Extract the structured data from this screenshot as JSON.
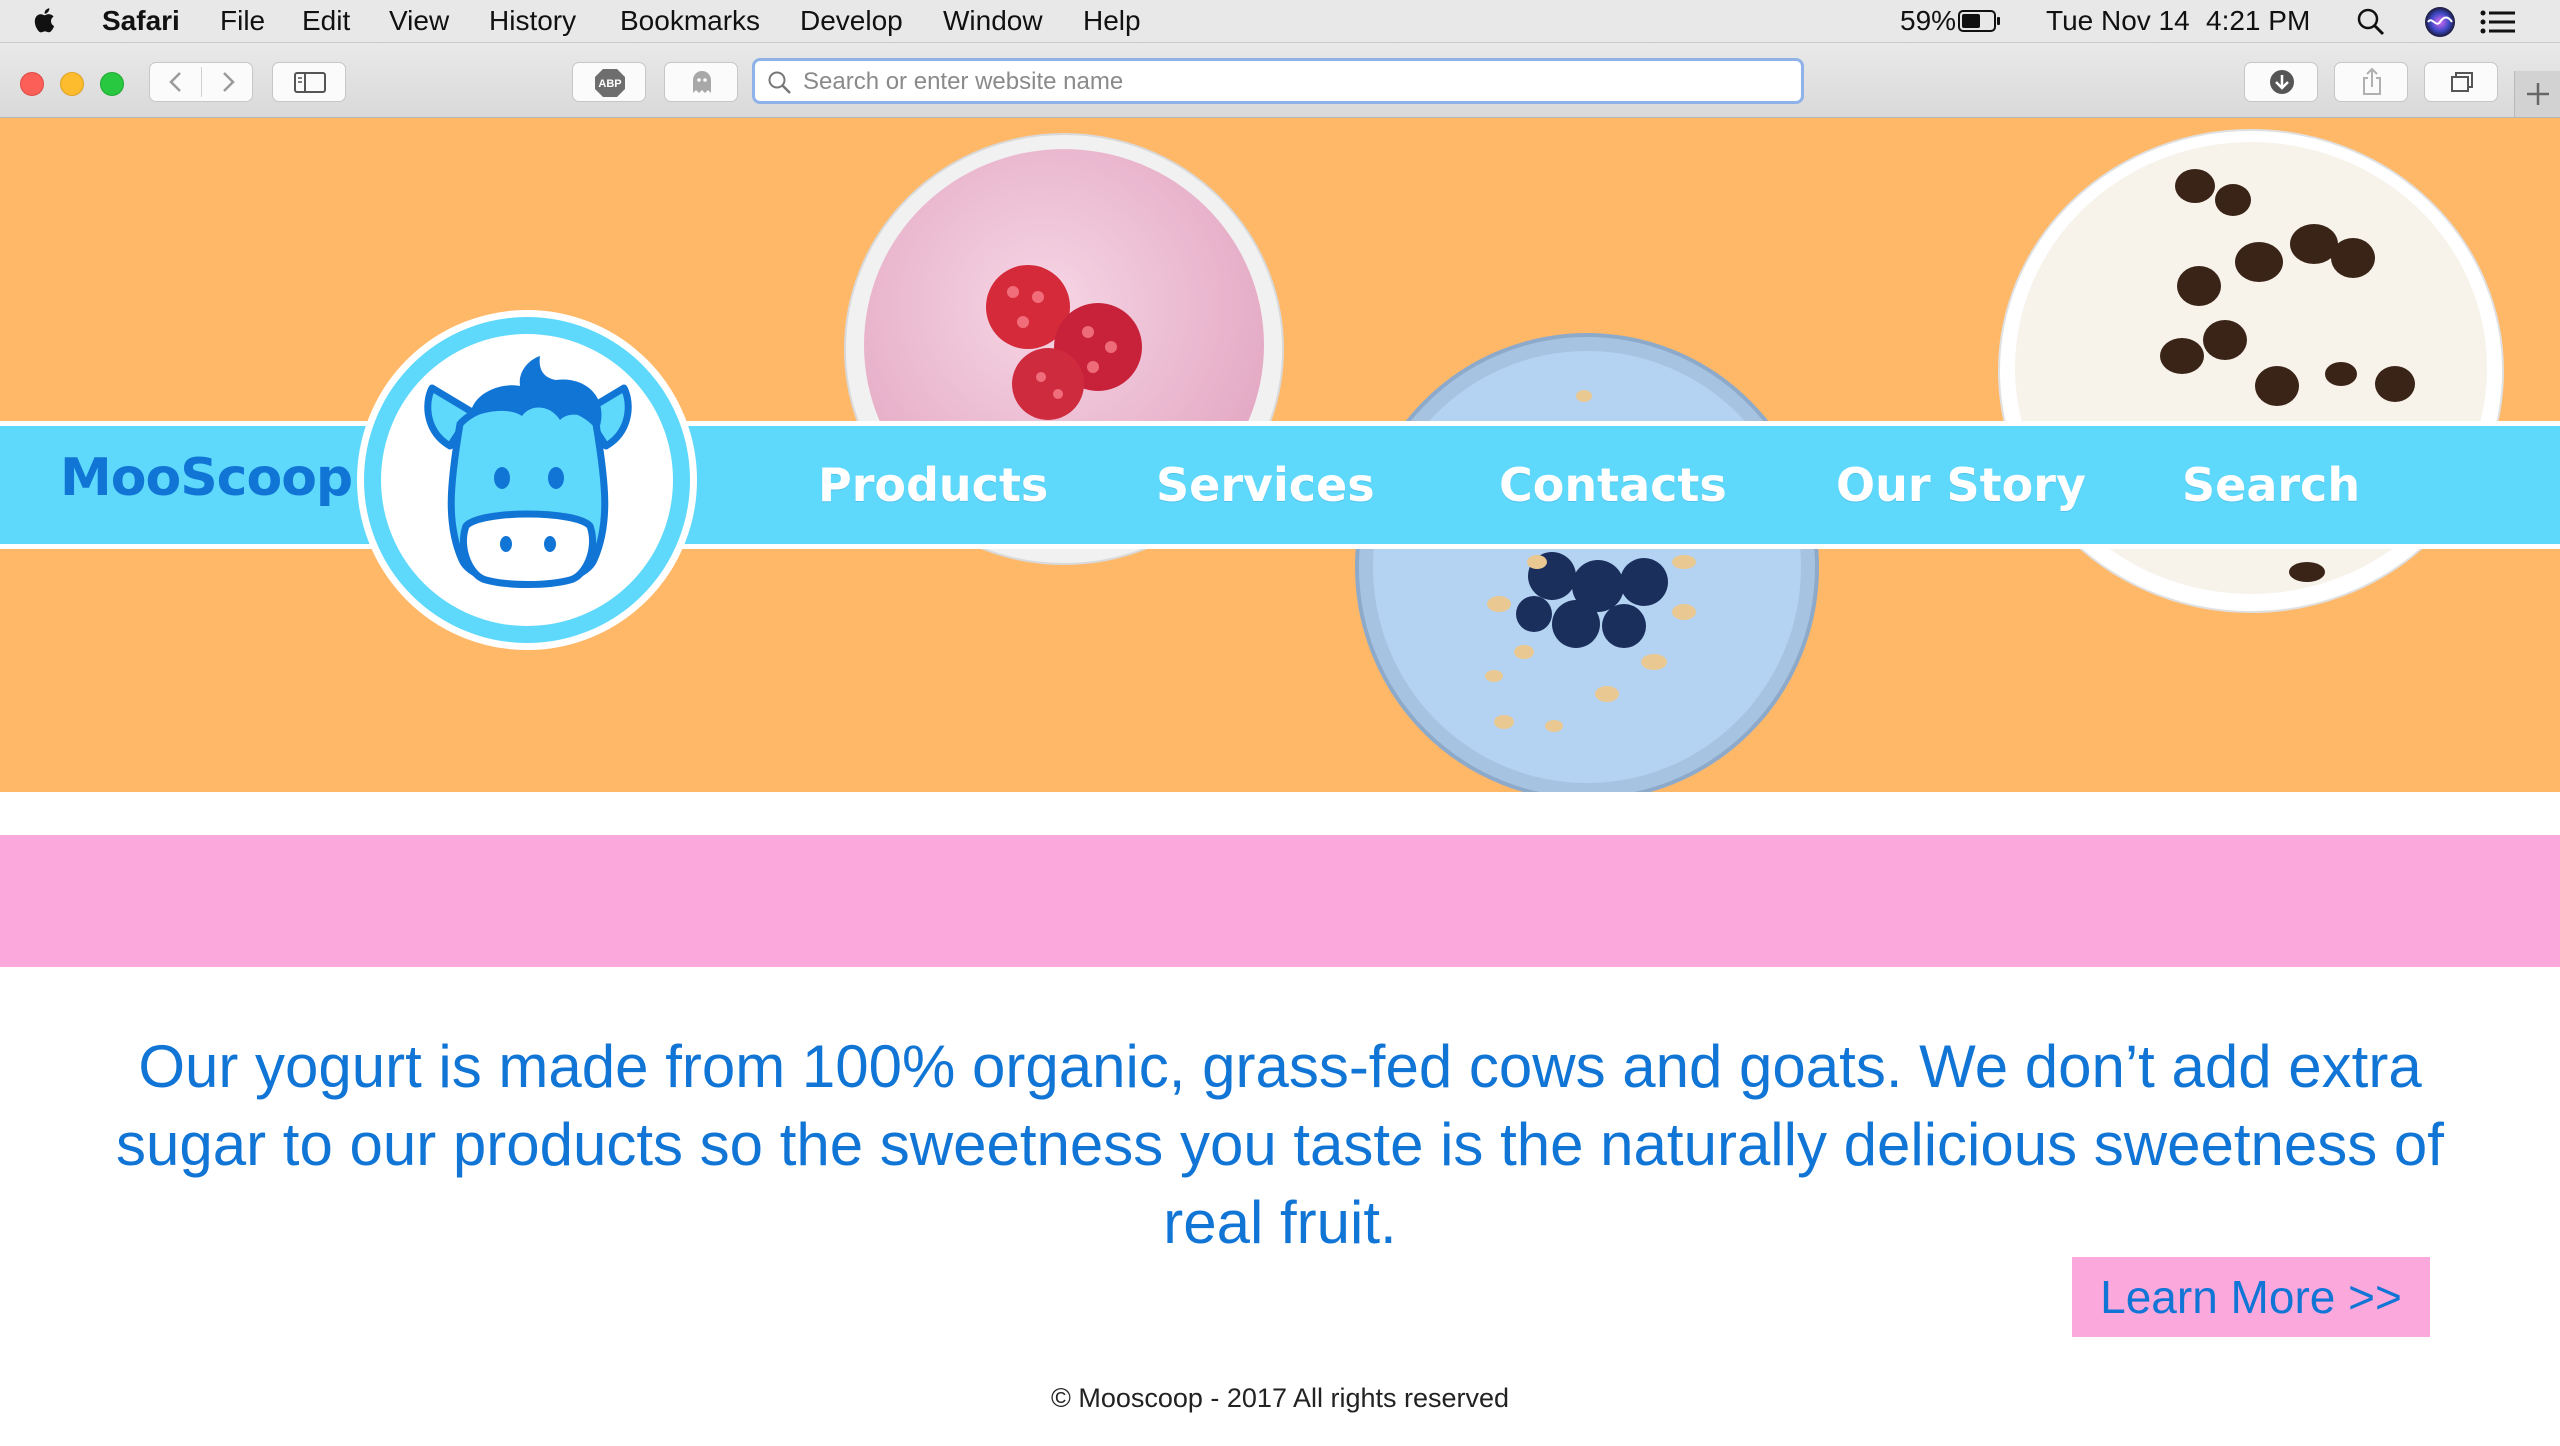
{
  "menubar": {
    "app_name": "Safari",
    "items": [
      "File",
      "Edit",
      "View",
      "History",
      "Bookmarks",
      "Develop",
      "Window",
      "Help"
    ],
    "battery_percent": "59%",
    "date": "Tue Nov 14",
    "time": "4:21 PM"
  },
  "toolbar": {
    "adblock_label": "ABP",
    "url_placeholder": "Search or enter website name"
  },
  "site": {
    "logo_text": "MooScoop",
    "nav": [
      "Products",
      "Services",
      "Contacts",
      "Our Story",
      "Search"
    ],
    "tagline": "Our yogurt is made from 100% organic, grass-fed cows and goats. We don’t add extra sugar to our products so the sweetness you taste is the naturally delicious sweetness of real fruit.",
    "cta": "Learn More >>",
    "footer": "© Mooscoop - 2017 All rights reserved"
  },
  "colors": {
    "hero_bg": "#ffb868",
    "nav_band": "#5ed8fb",
    "brand_blue": "#1175d6",
    "pink": "#fba8dc"
  }
}
